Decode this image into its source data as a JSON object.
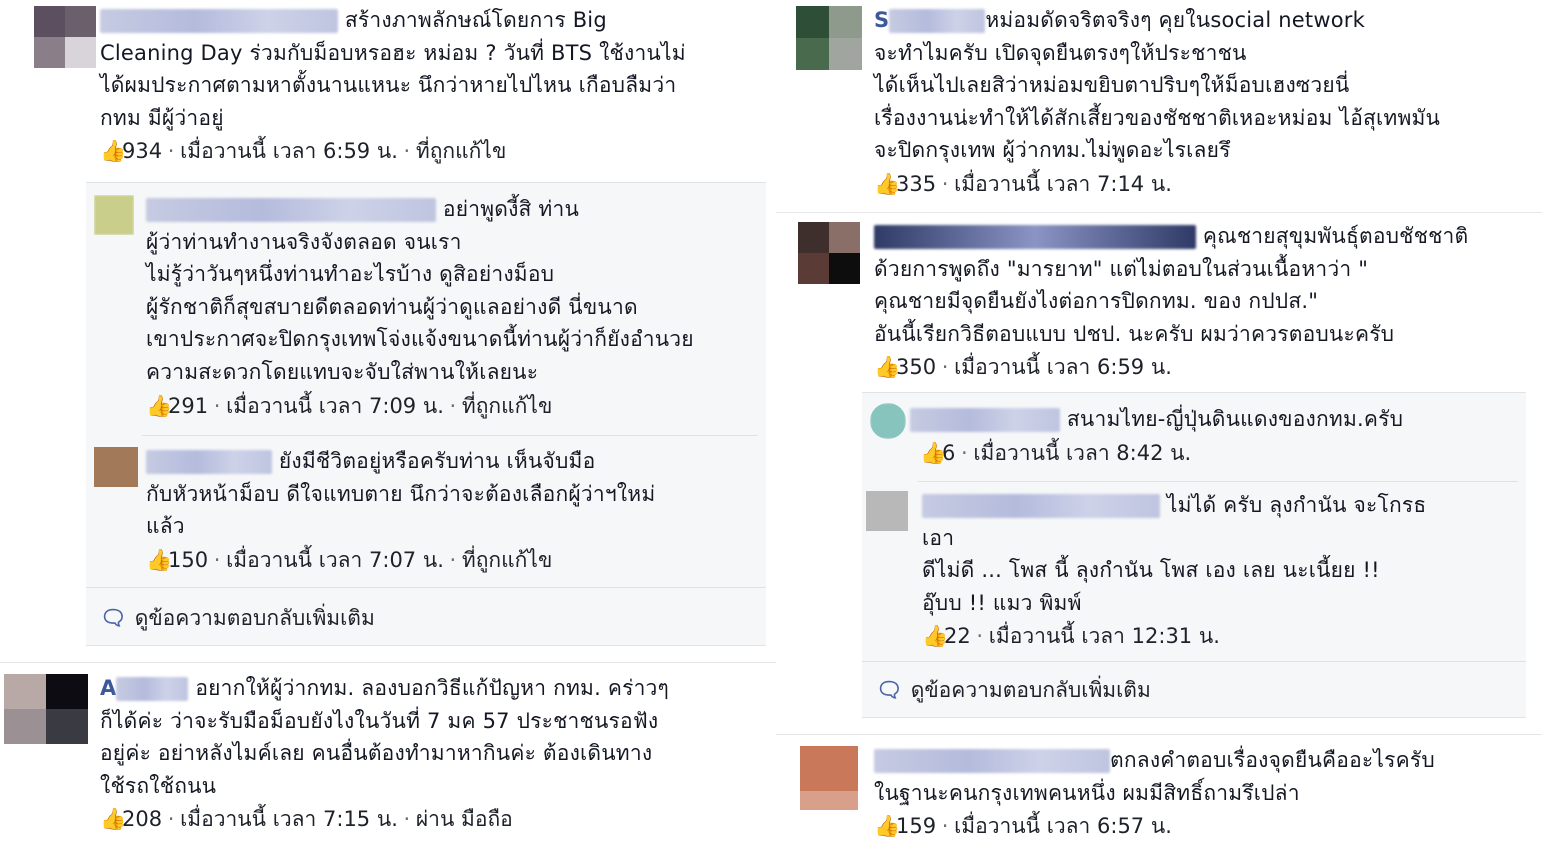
{
  "left": {
    "post1": {
      "text_lines": [
        "สร้างภาพลักษณ์โดยการ Big",
        "Cleaning Day ร่วมกับม็อบหรอฮะ หม่อม ? วันที่ BTS ใช้งานไม่",
        "ได้ผมประกาศตามหาตั้งนานแหนะ นึกว่าหายไปไหน เกือบลืมว่า",
        "กทม มีผู้ว่าอยู่"
      ],
      "likes": "934",
      "time": "เมื่อวานนี้ เวลา 6:59 น.",
      "extra": "ที่ถูกแก้ไข"
    },
    "reply1": {
      "text_lines": [
        "อย่าพูดงี้สิ ท่าน",
        "ผู้ว่าท่านทำงานจริงจังตลอด จนเรา",
        "ไม่รู้ว่าวันๆหนึ่งท่านทำอะไรบ้าง ดูสิอย่างม็อบ",
        "ผู้รักชาติก็สุขสบายดีตลอดท่านผู้ว่าดูแลอย่างดี นี่ขนาด",
        "เขาประกาศจะปิดกรุงเทพโจ่งแจ้งขนาดนี้ท่านผู้ว่าก็ยังอำนวย",
        "ความสะดวกโดยแทบจะจับใส่พานให้เลยนะ"
      ],
      "likes": "291",
      "time": "เมื่อวานนี้ เวลา 7:09 น.",
      "extra": "ที่ถูกแก้ไข"
    },
    "reply2": {
      "text_lines": [
        "ยังมีชีวิตอยู่หรือครับท่าน เห็นจับมือ",
        "กับหัวหน้าม็อบ ดีใจแทบตาย นึกว่าจะต้องเลือกผู้ว่าฯใหม่",
        "แล้ว"
      ],
      "likes": "150",
      "time": "เมื่อวานนี้ เวลา 7:07 น.",
      "extra": "ที่ถูกแก้ไข"
    },
    "more_replies": "ดูข้อความตอบกลับเพิ่มเติม",
    "post2": {
      "name_initial": "A",
      "text_lines": [
        "อยากให้ผู้ว่ากทม. ลองบอกวิธีแก้ปัญหา กทม. คร่าวๆ",
        "ก็ได้ค่ะ ว่าจะรับมือม็อบยังไงในวันที่ 7 มค 57 ประชาชนรอฟัง",
        "อยู่ค่ะ อย่าหลังไมค์เลย คนอื่นต้องทำมาหากินค่ะ ต้องเดินทาง",
        "ใช้รถใช้ถนน"
      ],
      "likes": "208",
      "time": "เมื่อวานนี้ เวลา 7:15 น.",
      "extra": "ผ่าน มือถือ"
    }
  },
  "right": {
    "post1": {
      "name_initial": "S",
      "text_lines": [
        "หม่อมดัดจริตจริงๆ คุยในsocial network",
        "จะทำไมครับ เปิดจุดยืนตรงๆให้ประชาชน",
        "ได้เห็นไปเลยสิว่าหม่อมขยิบตาปริบๆให้ม็อบเฮงซวยนี่",
        "เรื่องงานน่ะทำให้ได้สักเสี้ยวของชัชชาติเหอะหม่อม ไอ้สุเทพมัน",
        "จะปิดกรุงเทพ ผู้ว่ากทม.ไม่พูดอะไรเลยรึ"
      ],
      "likes": "335",
      "time": "เมื่อวานนี้ เวลา 7:14 น."
    },
    "post2": {
      "text_lines": [
        "คุณชายสุขุมพันธุ์ตอบชัชชาติ",
        "ด้วยการพูดถึง \"มารยาท\" แต่ไม่ตอบในส่วนเนื้อหาว่า \"",
        "คุณชายมีจุดยืนยังไงต่อการปิดกทม. ของ กปปส.\"",
        "อันนี้เรียกวิธีตอบแบบ ปชป. นะครับ ผมว่าควรตอบนะครับ"
      ],
      "likes": "350",
      "time": "เมื่อวานนี้ เวลา 6:59 น."
    },
    "reply1": {
      "text_lines": [
        "สนามไทย-ญี่ปุ่นดินแดงของกทม.ครับ"
      ],
      "likes": "6",
      "time": "เมื่อวานนี้ เวลา 8:42 น."
    },
    "reply2": {
      "text_lines": [
        "ไม่ได้ ครับ ลุงกำนัน จะโกรธ",
        "เอา",
        "ดีไม่ดี ... โพส นี้ ลุงกำนัน โพส เอง เลย นะเนี้ยย !!",
        "อุ๊บบ !! แมว พิมพ์"
      ],
      "likes": "22",
      "time": "เมื่อวานนี้ เวลา 12:31 น."
    },
    "more_replies": "ดูข้อความตอบกลับเพิ่มเติม",
    "post3": {
      "text_lines": [
        "ตกลงคำตอบเรื่องจุดยืนคืออะไรครับ",
        "ในฐานะคนกรุงเทพคนหนึ่ง ผมมีสิทธิ์ถามรึเปล่า"
      ],
      "likes": "159",
      "time": "เมื่อวานนี้ เวลา 6:57 น."
    }
  },
  "icons": {
    "like": "thumbs-up-icon",
    "reply": "speech-bubble-icon"
  },
  "colors": {
    "link": "#4c66a4",
    "reply_bg": "#f6f7f9",
    "text": "#141823"
  }
}
